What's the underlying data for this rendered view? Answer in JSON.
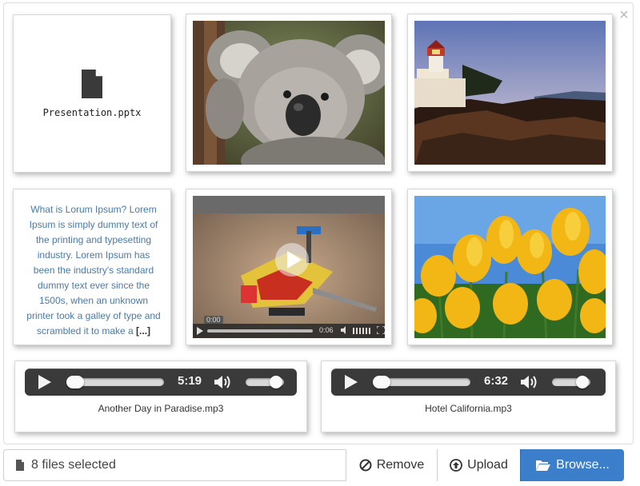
{
  "close_glyph": "×",
  "files": [
    {
      "kind": "document",
      "name": "Presentation.pptx",
      "icon": "file-icon"
    },
    {
      "kind": "image",
      "subject": "koala"
    },
    {
      "kind": "image",
      "subject": "lighthouse"
    },
    {
      "kind": "text",
      "content": "What is Lorum Ipsum? Lorem Ipsum is simply dummy text of the printing and typesetting industry. Lorem Ipsum has been the industry's standard dummy text ever since the 1500s, when an unknown printer took a galley of type and scrambled it to make a",
      "more": "[...]"
    },
    {
      "kind": "video",
      "current_time": "0:00",
      "duration": "0:06"
    },
    {
      "kind": "image",
      "subject": "yellow tulips"
    },
    {
      "kind": "audio",
      "name": "Another Day in Paradise.mp3",
      "time": "5:19",
      "progress": 0.08,
      "volume": 0.85
    },
    {
      "kind": "audio",
      "name": "Hotel California.mp3",
      "time": "6:32",
      "progress": 0.08,
      "volume": 0.85
    }
  ],
  "footer": {
    "status_text": "8 files selected",
    "remove_label": "Remove",
    "upload_label": "Upload",
    "browse_label": "Browse..."
  },
  "colors": {
    "browse_button": "#3b7ec9",
    "text_preview": "#4a7aa6",
    "player_bg": "#3a3a3a"
  }
}
